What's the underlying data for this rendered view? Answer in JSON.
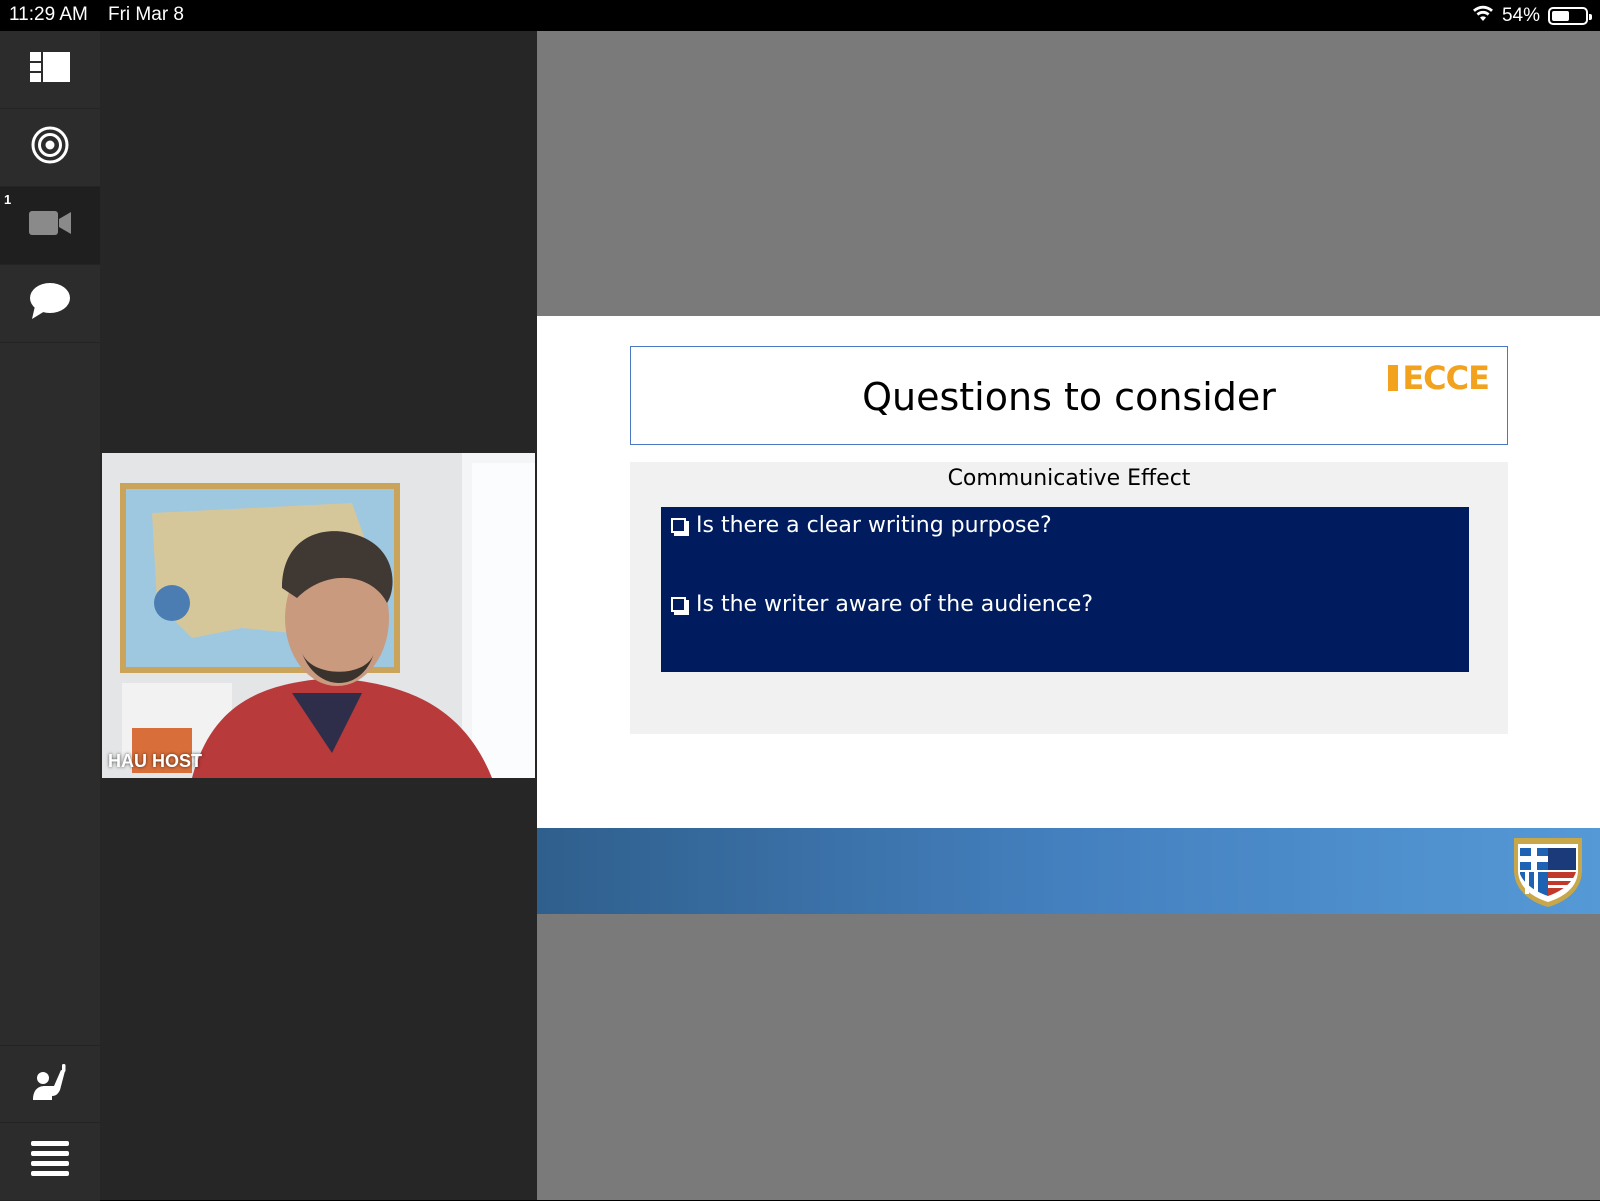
{
  "status_bar": {
    "time": "11:29 AM",
    "date": "Fri Mar 8",
    "battery_percent": "54%",
    "battery_level": 0.54,
    "wifi_icon": "wifi-icon"
  },
  "sidebar": {
    "items": [
      {
        "name": "layout-icon"
      },
      {
        "name": "target-icon"
      },
      {
        "name": "video-camera-icon",
        "badge": "1"
      },
      {
        "name": "chat-bubble-icon"
      },
      {
        "name": "raise-hand-icon"
      },
      {
        "name": "menu-icon"
      }
    ]
  },
  "video": {
    "participant_name": "HAU HOST"
  },
  "slide": {
    "title": "Questions to consider",
    "logo_text": "ECCE",
    "section_heading": "Communicative Effect",
    "questions": [
      "Is there a clear writing purpose?",
      "Is the writer aware of the audience?"
    ],
    "colors": {
      "accent_orange": "#f2a21c",
      "question_box": "#001c5e",
      "footer_blue": "#4480bf"
    }
  }
}
